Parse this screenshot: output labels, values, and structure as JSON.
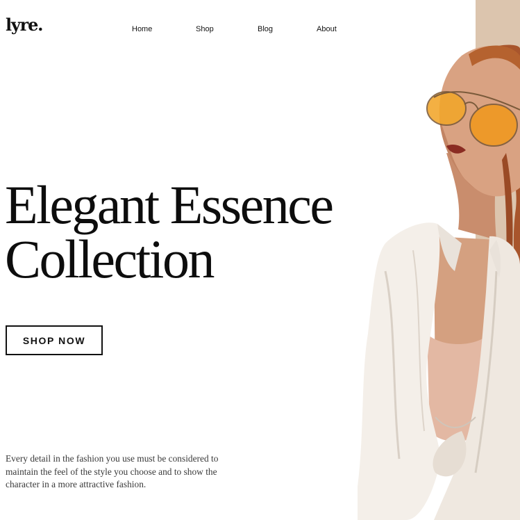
{
  "brand": {
    "logo_text": "lyre."
  },
  "nav": {
    "items": [
      {
        "label": "Home"
      },
      {
        "label": "Shop"
      },
      {
        "label": "Blog"
      },
      {
        "label": "About"
      }
    ]
  },
  "hero": {
    "title_lines": [
      "Elegant Essence",
      "Collection"
    ],
    "cta_label": "SHOP NOW",
    "description_lines": [
      "Every detail in the fashion you use must be considered to",
      "maintain the feel of the style you choose and to show the",
      "character in a more attractive fashion."
    ]
  },
  "colors": {
    "background": "#ffffff",
    "accent_block": "#dcc5ae",
    "text": "#111111",
    "sunglasses": "#f2a62a",
    "shirt": "#f4efe9"
  },
  "image": {
    "subject": "model-photo"
  }
}
